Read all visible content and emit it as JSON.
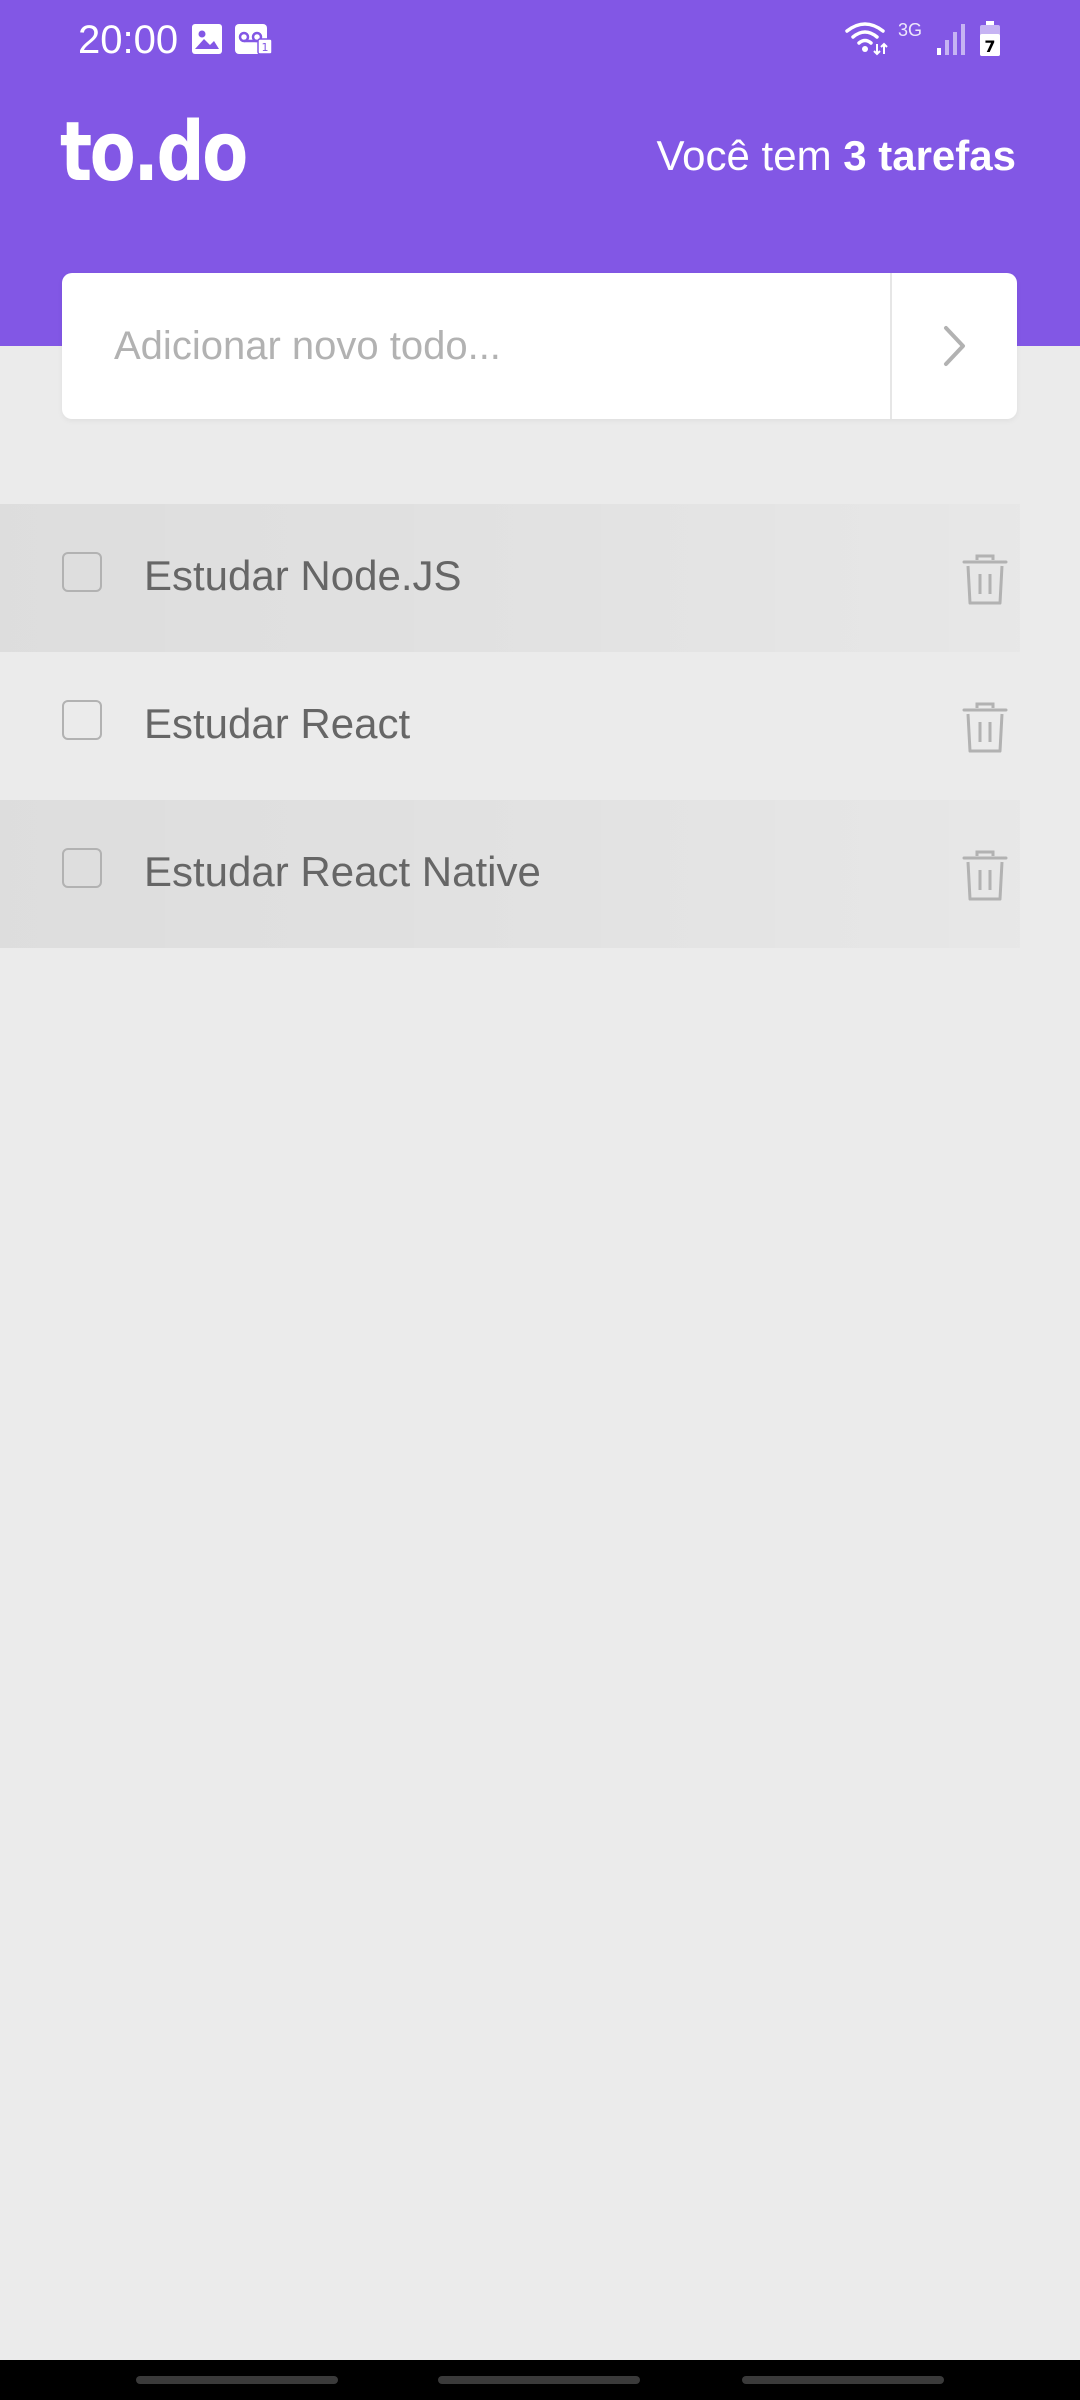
{
  "status_bar": {
    "time": "20:00",
    "network_type": "3G",
    "battery_level": "7",
    "icons": [
      "image-icon",
      "voicemail-icon",
      "wifi-icon",
      "signal-icon",
      "battery-icon"
    ]
  },
  "header": {
    "logo": "to.do",
    "counter_prefix": "Você tem ",
    "counter_value": "3 tarefas",
    "accent_color": "#8257E5"
  },
  "new_todo": {
    "placeholder": "Adicionar novo todo...",
    "value": "",
    "submit_icon": "chevron-right-icon"
  },
  "tasks": [
    {
      "title": "Estudar Node.JS",
      "done": false
    },
    {
      "title": "Estudar React",
      "done": false
    },
    {
      "title": "Estudar React Native",
      "done": false
    }
  ],
  "colors": {
    "background": "#EBEBEB",
    "task_text": "#666666",
    "icon_gray": "#B2B2B2"
  }
}
